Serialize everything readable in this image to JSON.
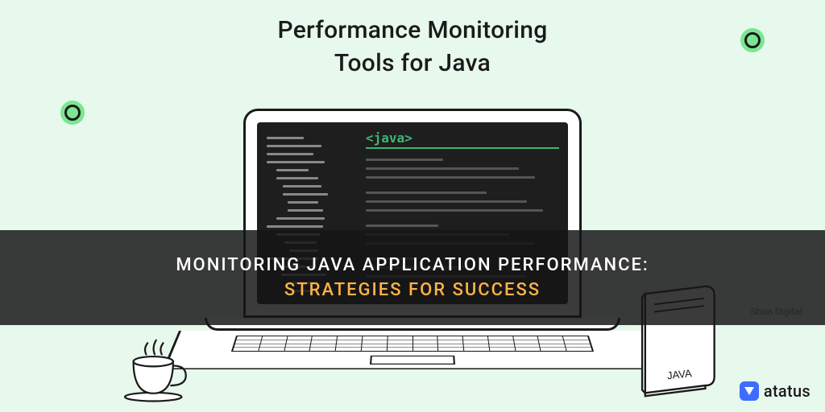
{
  "header": {
    "line1": "Performance Monitoring",
    "line2": "Tools for Java"
  },
  "code": {
    "tag": "<java>"
  },
  "overlay": {
    "line1": "MONITORING JAVA APPLICATION PERFORMANCE:",
    "line2": "STRATEGIES FOR SUCCESS"
  },
  "book": {
    "label": "JAVA"
  },
  "brand": {
    "name": "atatus"
  },
  "watermark": "Shun Digital"
}
